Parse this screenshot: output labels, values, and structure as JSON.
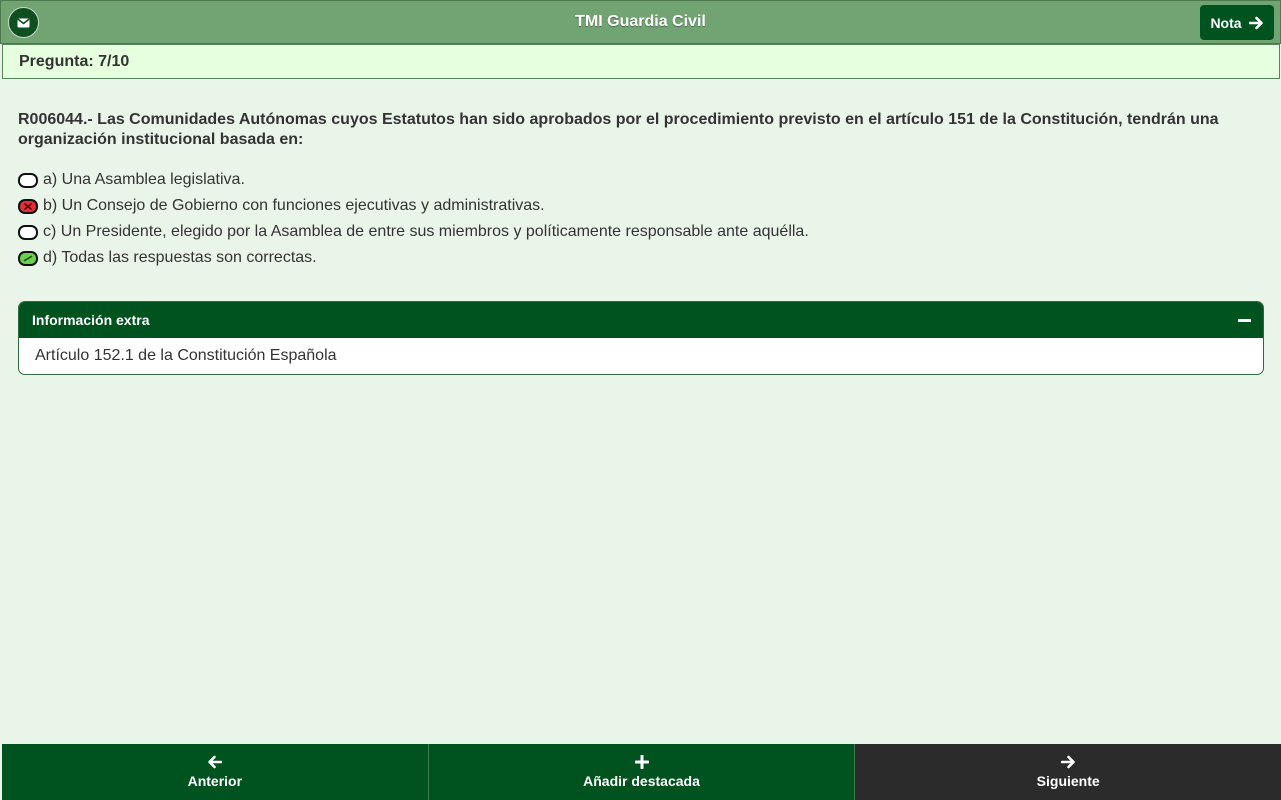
{
  "header": {
    "title": "TMI Guardia Civil",
    "nota_label": "Nota",
    "mail_icon": "envelope-icon",
    "nota_icon": "arrow-right-icon"
  },
  "subheader": {
    "pregunta": "Pregunta: 7/10"
  },
  "question": {
    "text": "R006044.- Las Comunidades Autónomas cuyos Estatutos han sido aprobados por el procedimiento previsto en el artículo 151 de la Constitución, tendrán una organización institucional basada en:",
    "options": [
      {
        "label": "a) Una Asamblea legislativa.",
        "state": "unselected"
      },
      {
        "label": "b) Un Consejo de Gobierno con funciones ejecutivas y administrativas.",
        "state": "wrong"
      },
      {
        "label": "c) Un Presidente, elegido por la Asamblea de entre sus miembros y políticamente responsable ante aquélla.",
        "state": "unselected"
      },
      {
        "label": "d) Todas las respuestas son correctas.",
        "state": "correct"
      }
    ]
  },
  "info": {
    "title": "Información extra",
    "body": "Artículo 152.1 de la Constitución Española"
  },
  "footer": {
    "prev_label": "Anterior",
    "add_label": "Añadir destacada",
    "next_label": "Siguiente"
  },
  "colors": {
    "header_bg": "#72a372",
    "dark_green": "#00521f",
    "page_bg": "#eaf5ea",
    "wrong": "#e0313a",
    "correct": "#6ccf52",
    "next_bg": "#2b2b2b"
  }
}
